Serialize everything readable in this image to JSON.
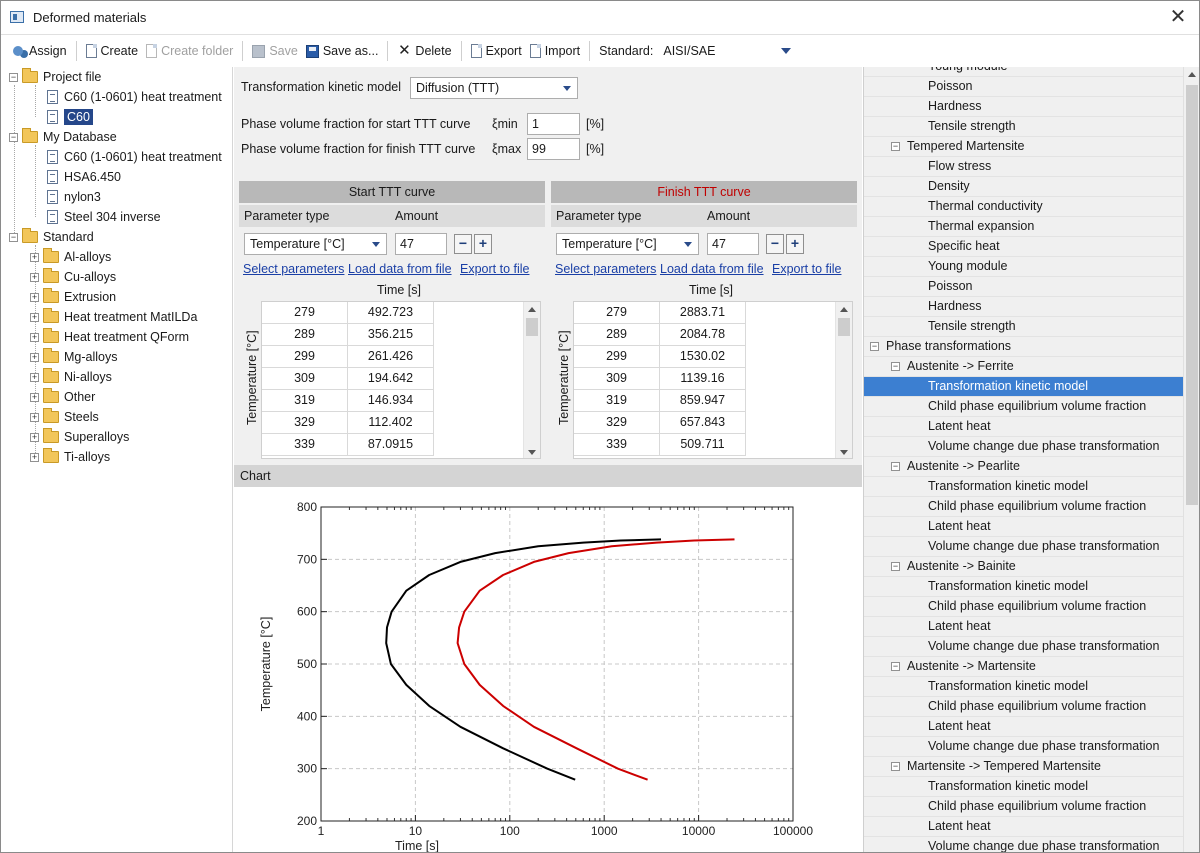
{
  "window": {
    "title": "Deformed materials",
    "close_glyph": "✕"
  },
  "toolbar": {
    "assign": "Assign",
    "create": "Create",
    "create_folder": "Create folder",
    "save": "Save",
    "save_as": "Save as...",
    "delete": "Delete",
    "export": "Export",
    "import": "Import",
    "standard_label": "Standard:",
    "standard_value": "AISI/SAE"
  },
  "tree": {
    "project_file": "Project file",
    "project_items": [
      "C60 (1-0601) heat treatment",
      "C60"
    ],
    "my_database": "My Database",
    "db_items": [
      "C60 (1-0601) heat treatment",
      "HSA6.450",
      "nylon3",
      "Steel 304 inverse"
    ],
    "standard": "Standard",
    "standard_items": [
      "Al-alloys",
      "Cu-alloys",
      "Extrusion",
      "Heat treatment MatILDa",
      "Heat treatment QForm",
      "Mg-alloys",
      "Ni-alloys",
      "Other",
      "Steels",
      "Superalloys",
      "Ti-alloys"
    ]
  },
  "kinetics": {
    "model_label": "Transformation kinetic model",
    "model_value": "Diffusion (TTT)",
    "start_label": "Phase volume fraction for start TTT curve",
    "start_sym": "ξmin",
    "start_value": "1",
    "start_unit": "[%]",
    "finish_label": "Phase volume fraction for finish TTT curve",
    "finish_sym": "ξmax",
    "finish_value": "99",
    "finish_unit": "[%]"
  },
  "start_curve": {
    "title": "Start TTT curve",
    "param_type": "Parameter type",
    "amount": "Amount",
    "param_value": "Temperature [°C]",
    "amount_value": "47",
    "minus": "−",
    "plus": "+",
    "select_params": "Select parameters",
    "load_data": "Load data from file",
    "export": "Export to file",
    "time_header": "Time [s]",
    "temp_header": "Temperature [°C]",
    "rows": [
      [
        "279",
        "492.723"
      ],
      [
        "289",
        "356.215"
      ],
      [
        "299",
        "261.426"
      ],
      [
        "309",
        "194.642"
      ],
      [
        "319",
        "146.934"
      ],
      [
        "329",
        "112.402"
      ],
      [
        "339",
        "87.0915"
      ]
    ]
  },
  "finish_curve": {
    "title": "Finish TTT curve",
    "param_type": "Parameter type",
    "amount": "Amount",
    "param_value": "Temperature [°C]",
    "amount_value": "47",
    "minus": "−",
    "plus": "+",
    "select_params": "Select parameters",
    "load_data": "Load data from file",
    "export": "Export to file",
    "time_header": "Time [s]",
    "temp_header": "Temperature [°C]",
    "rows": [
      [
        "279",
        "2883.71"
      ],
      [
        "289",
        "2084.78"
      ],
      [
        "299",
        "1530.02"
      ],
      [
        "309",
        "1139.16"
      ],
      [
        "319",
        "859.947"
      ],
      [
        "329",
        "657.843"
      ],
      [
        "339",
        "509.711"
      ]
    ]
  },
  "chart": {
    "section_title": "Chart"
  },
  "chart_data": {
    "type": "line",
    "xlabel": "Time [s]",
    "ylabel": "Temperature [°C]",
    "x_scale": "log",
    "xlim": [
      1,
      100000
    ],
    "ylim": [
      200,
      800
    ],
    "x_ticks": [
      "1",
      "10",
      "100",
      "1000",
      "10000",
      "100000"
    ],
    "y_ticks": [
      "200",
      "300",
      "400",
      "500",
      "600",
      "700",
      "800"
    ],
    "grid": true,
    "series": [
      {
        "color": "#000000",
        "points": [
          [
            492.7,
            279
          ],
          [
            250,
            300
          ],
          [
            85,
            339
          ],
          [
            30,
            380
          ],
          [
            14,
            420
          ],
          [
            8,
            460
          ],
          [
            5.5,
            500
          ],
          [
            4.9,
            540
          ],
          [
            5,
            570
          ],
          [
            5.6,
            600
          ],
          [
            8,
            640
          ],
          [
            14,
            670
          ],
          [
            30,
            695
          ],
          [
            70,
            712
          ],
          [
            200,
            725
          ],
          [
            600,
            732
          ],
          [
            1500,
            736
          ],
          [
            4000,
            738
          ]
        ]
      },
      {
        "color": "#cc0000",
        "points": [
          [
            2883.7,
            279
          ],
          [
            1400,
            300
          ],
          [
            510,
            339
          ],
          [
            180,
            380
          ],
          [
            85,
            420
          ],
          [
            48,
            460
          ],
          [
            33,
            500
          ],
          [
            28,
            540
          ],
          [
            29,
            570
          ],
          [
            33,
            600
          ],
          [
            48,
            640
          ],
          [
            85,
            670
          ],
          [
            180,
            695
          ],
          [
            420,
            712
          ],
          [
            1200,
            725
          ],
          [
            3600,
            732
          ],
          [
            9000,
            736
          ],
          [
            24000,
            738
          ]
        ]
      }
    ]
  },
  "props": {
    "top_partial": "Young module",
    "group1_items": [
      "Poisson",
      "Hardness",
      "Tensile strength"
    ],
    "tempered": "Tempered Martensite",
    "tempered_items": [
      "Flow stress",
      "Density",
      "Thermal conductivity",
      "Thermal expansion",
      "Specific heat",
      "Young module",
      "Poisson",
      "Hardness",
      "Tensile strength"
    ],
    "phase_transformations": "Phase transformations",
    "transforms": [
      {
        "name": "Austenite -> Ferrite",
        "items": [
          "Transformation kinetic model",
          "Child phase equilibrium volume fraction",
          "Latent heat",
          "Volume change due phase transformation"
        ]
      },
      {
        "name": "Austenite -> Pearlite",
        "items": [
          "Transformation kinetic model",
          "Child phase equilibrium volume fraction",
          "Latent heat",
          "Volume change due phase transformation"
        ]
      },
      {
        "name": "Austenite -> Bainite",
        "items": [
          "Transformation kinetic model",
          "Child phase equilibrium volume fraction",
          "Latent heat",
          "Volume change due phase transformation"
        ]
      },
      {
        "name": "Austenite -> Martensite",
        "items": [
          "Transformation kinetic model",
          "Child phase equilibrium volume fraction",
          "Latent heat",
          "Volume change due phase transformation"
        ]
      },
      {
        "name": "Martensite -> Tempered Martensite",
        "items": [
          "Transformation kinetic model",
          "Child phase equilibrium volume fraction",
          "Latent heat",
          "Volume change due phase transformation"
        ]
      }
    ]
  }
}
